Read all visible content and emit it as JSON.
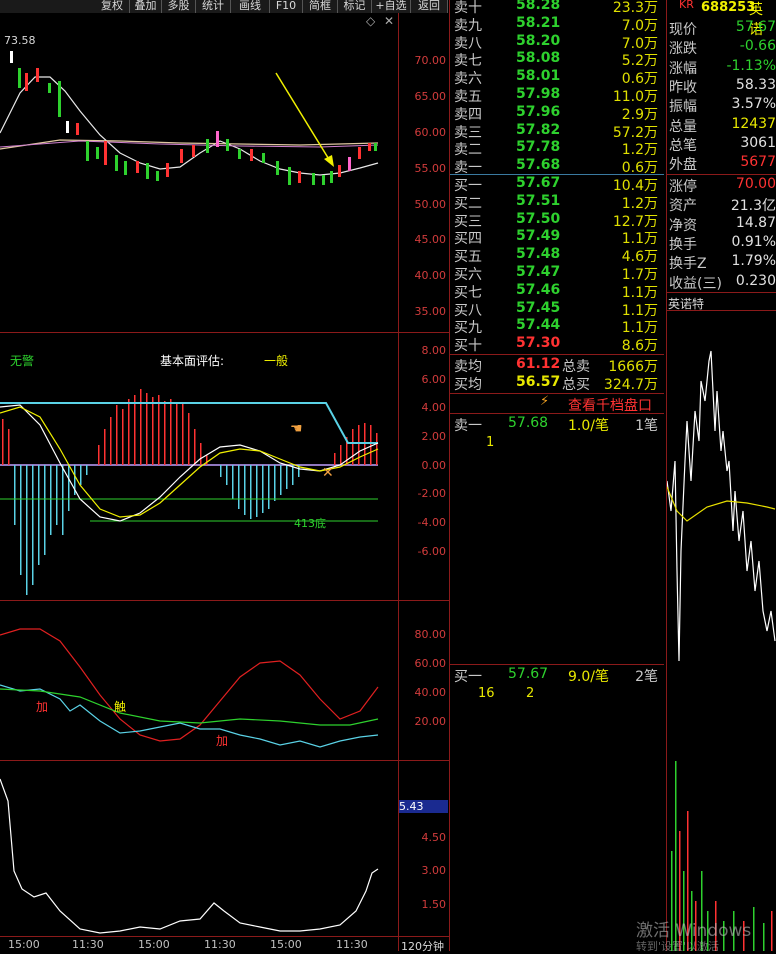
{
  "toolbar": {
    "buttons": [
      "复权",
      "叠加",
      "多股",
      "统计",
      "画线",
      "F10",
      "简框",
      "标记",
      "+自选",
      "返回"
    ],
    "diamond_icon": "◇",
    "close_icon": "✕"
  },
  "kline": {
    "high_label": "73.58",
    "axis": [
      "70.00",
      "65.00",
      "60.00",
      "55.00",
      "50.00",
      "45.00",
      "40.00",
      "35.00"
    ]
  },
  "macd": {
    "no_alert": "无警",
    "fundamental_label": "基本面评估:",
    "fundamental_value": "一般",
    "bottom_label": "413底",
    "axis": [
      "8.00",
      "6.00",
      "4.00",
      "2.00",
      "0.00",
      "-2.00",
      "-4.00",
      "-6.00"
    ]
  },
  "kdj": {
    "markers": [
      "加",
      "触",
      "加"
    ],
    "axis": [
      "80.00",
      "60.00",
      "40.00",
      "20.00"
    ]
  },
  "vol": {
    "current": "5.43",
    "axis": [
      "4.50",
      "3.00",
      "1.50"
    ],
    "period": "120分钟",
    "time_labels": [
      "15:00",
      "11:30",
      "15:00",
      "11:30",
      "15:00",
      "11:30"
    ]
  },
  "sell": [
    {
      "name": "卖十",
      "price": "58.28",
      "vol": "23.3万"
    },
    {
      "name": "卖九",
      "price": "58.21",
      "vol": "7.0万"
    },
    {
      "name": "卖八",
      "price": "58.20",
      "vol": "7.0万"
    },
    {
      "name": "卖七",
      "price": "58.08",
      "vol": "5.2万"
    },
    {
      "name": "卖六",
      "price": "58.01",
      "vol": "0.6万"
    },
    {
      "name": "卖五",
      "price": "57.98",
      "vol": "11.0万"
    },
    {
      "name": "卖四",
      "price": "57.96",
      "vol": "2.9万"
    },
    {
      "name": "卖三",
      "price": "57.82",
      "vol": "57.2万"
    },
    {
      "name": "卖二",
      "price": "57.78",
      "vol": "1.2万"
    },
    {
      "name": "卖一",
      "price": "57.68",
      "vol": "0.6万"
    }
  ],
  "buy": [
    {
      "name": "买一",
      "price": "57.67",
      "vol": "10.4万"
    },
    {
      "name": "买二",
      "price": "57.51",
      "vol": "1.2万"
    },
    {
      "name": "买三",
      "price": "57.50",
      "vol": "12.7万"
    },
    {
      "name": "买四",
      "price": "57.49",
      "vol": "1.1万"
    },
    {
      "name": "买五",
      "price": "57.48",
      "vol": "4.6万"
    },
    {
      "name": "买六",
      "price": "57.47",
      "vol": "1.7万"
    },
    {
      "name": "买七",
      "price": "57.46",
      "vol": "1.1万"
    },
    {
      "name": "买八",
      "price": "57.45",
      "vol": "1.1万"
    },
    {
      "name": "买九",
      "price": "57.44",
      "vol": "1.1万"
    },
    {
      "name": "买十",
      "price": "57.30",
      "vol": "8.6万"
    }
  ],
  "avg": {
    "sell_avg_label": "卖均",
    "sell_avg": "61.12",
    "sell_total_label": "总卖",
    "sell_total": "1666万",
    "buy_avg_label": "买均",
    "buy_avg": "56.57",
    "buy_total_label": "总买",
    "buy_total": "324.7万"
  },
  "thousand_link": "查看千档盘口",
  "queue": {
    "sell1_label": "卖一",
    "sell1_price": "57.68",
    "sell1_vol": "1.0/笔",
    "sell1_count": "1笔",
    "sell1_detail": "1",
    "buy1_label": "买一",
    "buy1_price": "57.67",
    "buy1_vol": "9.0/笔",
    "buy1_count": "2笔",
    "buy1_d1": "16",
    "buy1_d2": "2"
  },
  "stock": {
    "badge": "KR",
    "code": "688253",
    "name": "英诺"
  },
  "info": [
    {
      "k": "现价",
      "v": "57.67",
      "c": "green"
    },
    {
      "k": "涨跌",
      "v": "-0.66",
      "c": "green"
    },
    {
      "k": "涨幅",
      "v": "-1.13%",
      "c": "green"
    },
    {
      "k": "昨收",
      "v": "58.33",
      "c": "white"
    },
    {
      "k": "振幅",
      "v": "3.57%",
      "c": "white"
    },
    {
      "k": "总量",
      "v": "12437",
      "c": "yellow"
    },
    {
      "k": "总笔",
      "v": "3061",
      "c": "white"
    },
    {
      "k": "外盘",
      "v": "5677",
      "c": "red"
    }
  ],
  "info2": [
    {
      "k": "涨停",
      "v": "70.00",
      "c": "red"
    },
    {
      "k": "资产",
      "v": "21.3亿",
      "c": "white"
    },
    {
      "k": "净资",
      "v": "14.87",
      "c": "white"
    },
    {
      "k": "换手",
      "v": "0.91%",
      "c": "white"
    },
    {
      "k": "换手Z",
      "v": "1.79%",
      "c": "white"
    },
    {
      "k": "收益(三)",
      "v": "0.230",
      "c": "white"
    }
  ],
  "mini": {
    "name": "英诺特"
  },
  "watermark": {
    "line1": "激活 Windows",
    "line2": "转到'设置'以激活 Windows。"
  }
}
